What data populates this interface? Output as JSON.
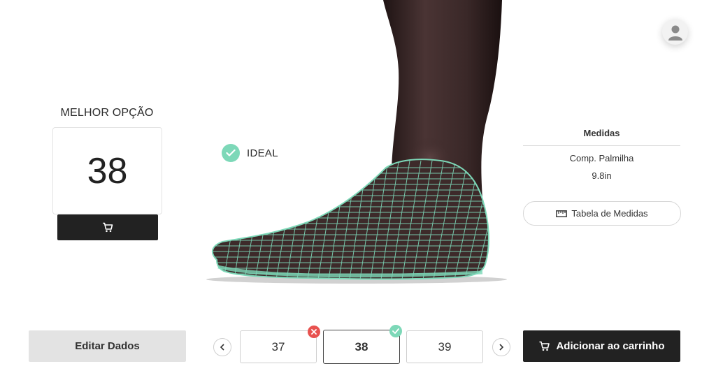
{
  "best_option": {
    "label": "MELHOR OPÇÃO",
    "size": "38",
    "cart_icon": "cart-icon"
  },
  "fit": {
    "label": "IDEAL",
    "icon": "check-circle-icon",
    "color": "#7dd8b8"
  },
  "measurements": {
    "title": "Medidas",
    "name": "Comp. Palmilha",
    "value": "9.8in",
    "table_button": "Tabela de Medidas",
    "table_icon": "ruler-icon"
  },
  "footer": {
    "edit_button": "Editar Dados",
    "sizes": [
      "37",
      "38",
      "39"
    ],
    "selected_size": "38",
    "add_to_cart": "Adicionar ao carrinho"
  },
  "colors": {
    "accent": "#7dd8b8",
    "error": "#e8524f",
    "dark": "#222222"
  }
}
